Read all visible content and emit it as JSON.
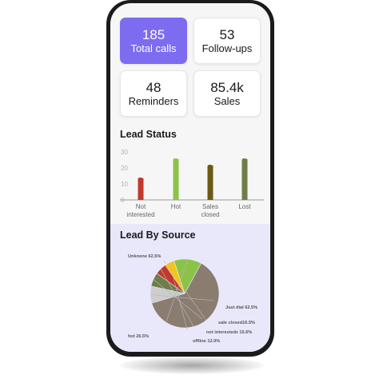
{
  "stats": [
    {
      "value": "185",
      "label": "Total calls"
    },
    {
      "value": "53",
      "label": "Follow-ups"
    },
    {
      "value": "48",
      "label": "Reminders"
    },
    {
      "value": "85.4k",
      "label": "Sales"
    }
  ],
  "lead_status": {
    "title": "Lead Status",
    "chart_data": {
      "type": "bar",
      "categories": [
        "Not interested",
        "Hot",
        "Sales closed",
        "Lost"
      ],
      "category_lines": [
        [
          "Not",
          "interested"
        ],
        [
          "Hot"
        ],
        [
          "Sales",
          "closed"
        ],
        [
          "Lost"
        ]
      ],
      "values": [
        14,
        26,
        22,
        26
      ],
      "yticks": [
        "30",
        "20",
        "10",
        "0"
      ],
      "ylim": [
        0,
        30
      ],
      "colors": [
        "#c0392b",
        "#8bc34a",
        "#6b5a14",
        "#6f7d4a"
      ]
    }
  },
  "lead_source": {
    "title": "Lead By Source",
    "chart_data": {
      "type": "pie",
      "slices": [
        {
          "label": "Unknone 62.5%",
          "value": 62.5,
          "color": "#8a7d70"
        },
        {
          "label": "Just dial 62.5%",
          "value": 8.0,
          "color": "#cdcdcd"
        },
        {
          "label": "sale closed16.5%",
          "value": 6.5,
          "color": "#6f7d4a"
        },
        {
          "label": "not interestedz 15.6%",
          "value": 5.5,
          "color": "#c0392b"
        },
        {
          "label": "offline 12.0%",
          "value": 4.5,
          "color": "#f5c518"
        },
        {
          "label": "hot 26.5%",
          "value": 13.0,
          "color": "#8bc34a"
        }
      ]
    }
  }
}
